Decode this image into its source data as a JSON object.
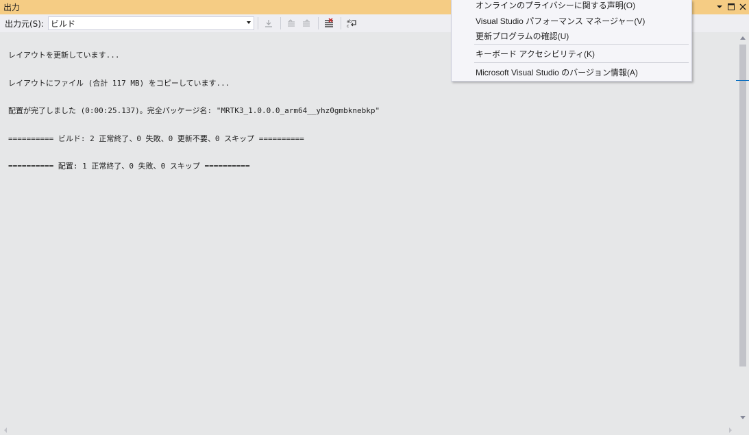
{
  "window": {
    "title": "出力"
  },
  "toolbar": {
    "source_label": "出力元(S):",
    "source_value": "ビルド"
  },
  "output": {
    "lines": [
      "レイアウトを更新しています...",
      "レイアウトにファイル (合計 117 MB) をコピーしています...",
      "配置が完了しました (0:00:25.137)。完全パッケージ名: \"MRTK3_1.0.0.0_arm64__yhz0gmbknebkp\"",
      "========== ビルド: 2 正常終了、0 失敗、0 更新不要、0 スキップ ==========",
      "========== 配置: 1 正常終了、0 失敗、0 スキップ =========="
    ]
  },
  "menu": {
    "items": [
      "オンラインのプライバシーに関する声明(O)",
      "Visual Studio パフォーマンス マネージャー(V)",
      "更新プログラムの確認(U)",
      "キーボード アクセシビリティ(K)",
      "Microsoft Visual Studio のバージョン情報(A)"
    ]
  },
  "colors": {
    "title_bar": "#f5cc84",
    "output_background": "#e6e7e8",
    "scroll_marker": "#0e70c0"
  },
  "icons": [
    "dropdown-arrow-icon",
    "maximize-icon",
    "close-icon",
    "go-to-location-icon",
    "previous-message-icon",
    "next-message-icon",
    "clear-all-icon",
    "word-wrap-icon"
  ]
}
